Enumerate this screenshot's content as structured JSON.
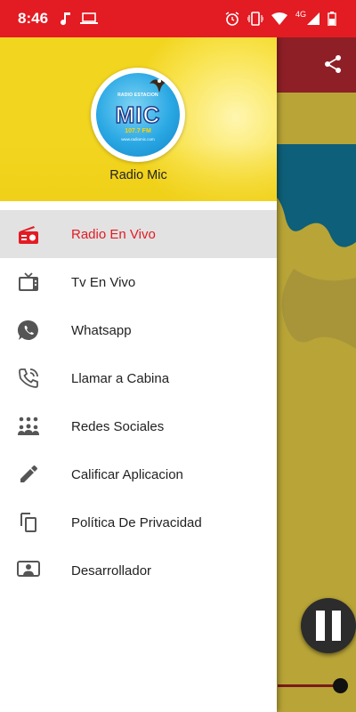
{
  "status_bar": {
    "time": "8:46",
    "network": "4G"
  },
  "drawer": {
    "header_title": "Radio Mic",
    "logo": {
      "top_text": "RADIO ESTACION",
      "brand": "MIC",
      "frequency": "107.7 FM",
      "web": "www.radiomic.com"
    },
    "items": [
      {
        "label": "Radio En Vivo",
        "icon": "radio-icon",
        "active": true
      },
      {
        "label": "Tv En Vivo",
        "icon": "tv-icon",
        "active": false
      },
      {
        "label": "Whatsapp",
        "icon": "whatsapp-icon",
        "active": false
      },
      {
        "label": "Llamar a Cabina",
        "icon": "phone-call-icon",
        "active": false
      },
      {
        "label": "Redes Sociales",
        "icon": "people-icon",
        "active": false
      },
      {
        "label": "Calificar Aplicacion",
        "icon": "pencil-icon",
        "active": false
      },
      {
        "label": "Política De Privacidad",
        "icon": "copy-icon",
        "active": false
      },
      {
        "label": "Desarrollador",
        "icon": "presenter-icon",
        "active": false
      }
    ]
  },
  "player": {
    "state": "playing"
  },
  "colors": {
    "status_bar": "#e31b23",
    "toolbar": "#8e1f26",
    "active_text": "#e31b23",
    "drawer_header": "#f2d51f",
    "icon_gray": "#555555"
  }
}
